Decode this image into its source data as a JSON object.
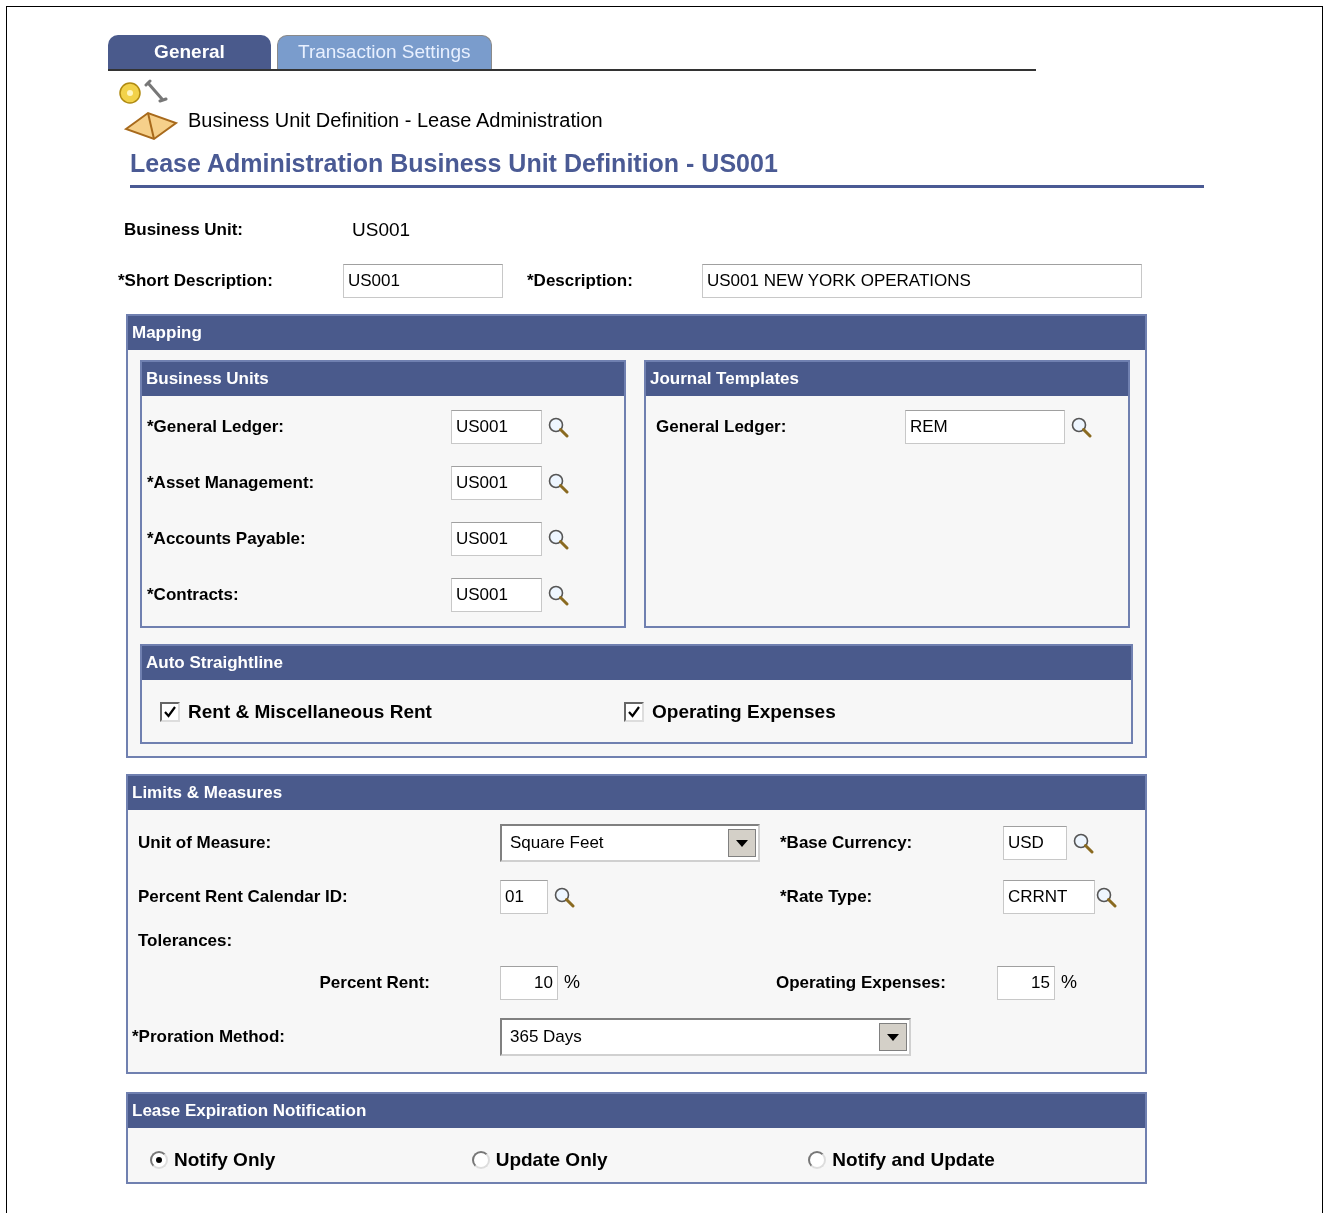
{
  "tabs": [
    {
      "label": "General",
      "selected": true
    },
    {
      "label": "Transaction Settings",
      "selected": false
    }
  ],
  "page_heading": "Business Unit Definition - Lease Administration",
  "title": "Lease Administration Business Unit Definition - US001",
  "business_unit": {
    "label": "Business Unit:",
    "value": "US001"
  },
  "short_description": {
    "label": "*Short Description:",
    "value": "US001"
  },
  "description": {
    "label": "*Description:",
    "value": "US001 NEW YORK OPERATIONS"
  },
  "mapping": {
    "title": "Mapping",
    "business_units": {
      "title": "Business Units",
      "fields": [
        {
          "label": "*General Ledger:",
          "value": "US001"
        },
        {
          "label": "*Asset Management:",
          "value": "US001"
        },
        {
          "label": "*Accounts Payable:",
          "value": "US001"
        },
        {
          "label": "*Contracts:",
          "value": "US001"
        }
      ]
    },
    "journal_templates": {
      "title": "Journal Templates",
      "fields": [
        {
          "label": "General Ledger:",
          "value": "REM"
        }
      ]
    },
    "auto_straightline": {
      "title": "Auto Straightline",
      "options": [
        {
          "label": "Rent & Miscellaneous Rent",
          "checked": true
        },
        {
          "label": "Operating Expenses",
          "checked": true
        }
      ]
    }
  },
  "limits": {
    "title": "Limits & Measures",
    "unit_of_measure": {
      "label": "Unit of Measure:",
      "value": "Square Feet"
    },
    "base_currency": {
      "label": "*Base Currency:",
      "value": "USD"
    },
    "percent_rent_calendar": {
      "label": "Percent Rent Calendar ID:",
      "value": "01"
    },
    "rate_type": {
      "label": "*Rate Type:",
      "value": "CRRNT"
    },
    "tolerances": "Tolerances:",
    "percent_rent": {
      "label": "Percent Rent:",
      "value": "10",
      "unit": "%"
    },
    "operating_expenses": {
      "label": "Operating Expenses:",
      "value": "15",
      "unit": "%"
    },
    "proration_method": {
      "label": "*Proration Method:",
      "value": "365 Days"
    }
  },
  "notification": {
    "title": "Lease Expiration Notification",
    "options": [
      {
        "label": "Notify Only",
        "selected": true
      },
      {
        "label": "Update Only",
        "selected": false
      },
      {
        "label": "Notify and Update",
        "selected": false
      }
    ]
  }
}
